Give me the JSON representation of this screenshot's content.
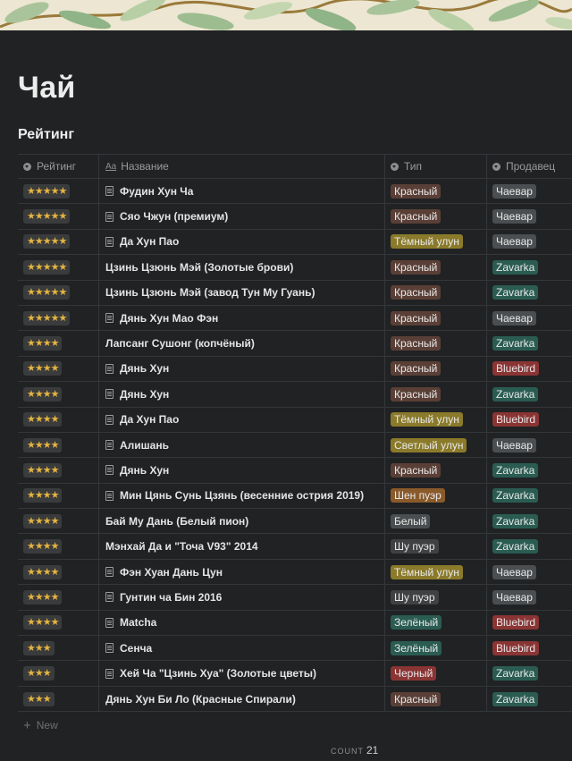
{
  "page": {
    "title": "Чай"
  },
  "view": {
    "title": "Рейтинг"
  },
  "columns": {
    "rating": "Рейтинг",
    "name": "Название",
    "type": "Тип",
    "seller": "Продавец"
  },
  "name_col_icon": "Aa",
  "tag_colors": {
    "Красный": "#5a3f36",
    "Тёмный улун": "#8a7a2a",
    "Светлый улун": "#8a7a2a",
    "Шен пуэр": "#8a5a2a",
    "Белый": "#4b4e50",
    "Шу пуэр": "#3f4143",
    "Зелёный": "#2a5c52",
    "Черный": "#8a3434",
    "Чаевар": "#4b4e50",
    "Zavarka": "#2a5c52",
    "Bluebird": "#8a3434"
  },
  "rows": [
    {
      "rating": "★★★★★",
      "name": "Фудин Хун Ча",
      "doc": true,
      "type": "Красный",
      "seller": "Чаевар"
    },
    {
      "rating": "★★★★★",
      "name": "Сяо Чжун (премиум)",
      "doc": true,
      "type": "Красный",
      "seller": "Чаевар"
    },
    {
      "rating": "★★★★★",
      "name": "Да Хун Пао",
      "doc": true,
      "type": "Тёмный улун",
      "seller": "Чаевар"
    },
    {
      "rating": "★★★★★",
      "name": "Цзинь Цзюнь Мэй (Золотые брови)",
      "doc": false,
      "type": "Красный",
      "seller": "Zavarka"
    },
    {
      "rating": "★★★★★",
      "name": "Цзинь Цзюнь Мэй (завод Тун Му Гуань)",
      "doc": false,
      "type": "Красный",
      "seller": "Zavarka"
    },
    {
      "rating": "★★★★★",
      "name": "Дянь Хун Мао Фэн",
      "doc": true,
      "type": "Красный",
      "seller": "Чаевар"
    },
    {
      "rating": "★★★★",
      "name": "Лапсанг Сушонг (копчёный)",
      "doc": false,
      "type": "Красный",
      "seller": "Zavarka"
    },
    {
      "rating": "★★★★",
      "name": "Дянь Хун",
      "doc": true,
      "type": "Красный",
      "seller": "Bluebird"
    },
    {
      "rating": "★★★★",
      "name": "Дянь Хун",
      "doc": true,
      "type": "Красный",
      "seller": "Zavarka"
    },
    {
      "rating": "★★★★",
      "name": "Да Хун Пао",
      "doc": true,
      "type": "Тёмный улун",
      "seller": "Bluebird"
    },
    {
      "rating": "★★★★",
      "name": "Алишань",
      "doc": true,
      "type": "Светлый улун",
      "seller": "Чаевар"
    },
    {
      "rating": "★★★★",
      "name": "Дянь Хун",
      "doc": true,
      "type": "Красный",
      "seller": "Zavarka"
    },
    {
      "rating": "★★★★",
      "name": "Мин Цянь Сунь Цзянь (весенние острия 2019)",
      "doc": true,
      "type": "Шен пуэр",
      "seller": "Zavarka"
    },
    {
      "rating": "★★★★",
      "name": "Бай Му Дань (Белый пион)",
      "doc": false,
      "type": "Белый",
      "seller": "Zavarka"
    },
    {
      "rating": "★★★★",
      "name": "Мэнхай Да и \"Точа V93\" 2014",
      "doc": false,
      "type": "Шу пуэр",
      "seller": "Zavarka"
    },
    {
      "rating": "★★★★",
      "name": "Фэн Хуан Дань Цун",
      "doc": true,
      "type": "Тёмный улун",
      "seller": "Чаевар"
    },
    {
      "rating": "★★★★",
      "name": "Гунтин ча Бин 2016",
      "doc": true,
      "type": "Шу пуэр",
      "seller": "Чаевар"
    },
    {
      "rating": "★★★★",
      "name": "Matcha",
      "doc": true,
      "type": "Зелёный",
      "seller": "Bluebird"
    },
    {
      "rating": "★★★",
      "name": "Сенча",
      "doc": true,
      "type": "Зелёный",
      "seller": "Bluebird"
    },
    {
      "rating": "★★★",
      "name": "Хей Ча \"Цзинь Хуа\" (Золотые цветы)",
      "doc": true,
      "type": "Черный",
      "seller": "Zavarka"
    },
    {
      "rating": "★★★",
      "name": "Дянь Хун Би Ло (Красные Спирали)",
      "doc": false,
      "type": "Красный",
      "seller": "Zavarka"
    }
  ],
  "footer": {
    "new_label": "New",
    "count_label": "COUNT",
    "count_value": "21"
  }
}
